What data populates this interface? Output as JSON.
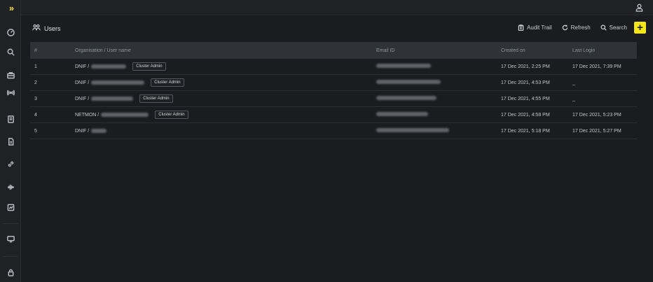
{
  "app": {
    "logo": "»"
  },
  "sidebar": {
    "items": [
      {
        "icon": "dashboard-icon"
      },
      {
        "icon": "search-icon"
      },
      {
        "icon": "briefcase-icon"
      },
      {
        "icon": "signal-icon"
      },
      {
        "icon": "book-icon"
      },
      {
        "icon": "document-icon"
      },
      {
        "icon": "link-icon"
      },
      {
        "icon": "waveform-icon"
      },
      {
        "icon": "chart-card-icon"
      },
      {
        "icon": "monitor-icon"
      },
      {
        "icon": "lock-icon"
      }
    ]
  },
  "topbar": {
    "user_icon": "user-icon"
  },
  "page": {
    "title": "Users",
    "toolbar": {
      "audit_label": "Audit Trail",
      "refresh_label": "Refresh",
      "search_label": "Search",
      "add_label": "+"
    }
  },
  "table": {
    "headers": [
      "#",
      "Organisation / User name",
      "Email ID",
      "Created on",
      "Last Login"
    ],
    "rows": [
      {
        "num": "1",
        "org": "DNIF /",
        "badge": "Cluster Admin",
        "created": "17 Dec 2021, 2:25 PM",
        "login": "17 Dec 2021, 7:39 PM"
      },
      {
        "num": "2",
        "org": "DNIF /",
        "badge": "Cluster Admin",
        "created": "17 Dec 2021, 4:53 PM",
        "login": "_"
      },
      {
        "num": "3",
        "org": "DNIF /",
        "badge": "Cluster Admin",
        "created": "17 Dec 2021, 4:55 PM",
        "login": "_"
      },
      {
        "num": "4",
        "org": "NETMON /",
        "badge": "Cluster Admin",
        "created": "17 Dec 2021, 4:58 PM",
        "login": "17 Dec 2021, 5:23 PM"
      },
      {
        "num": "5",
        "org": "DNIF /",
        "badge": "",
        "created": "17 Dec 2021, 5:18 PM",
        "login": "17 Dec 2021, 5:27 PM"
      }
    ]
  }
}
